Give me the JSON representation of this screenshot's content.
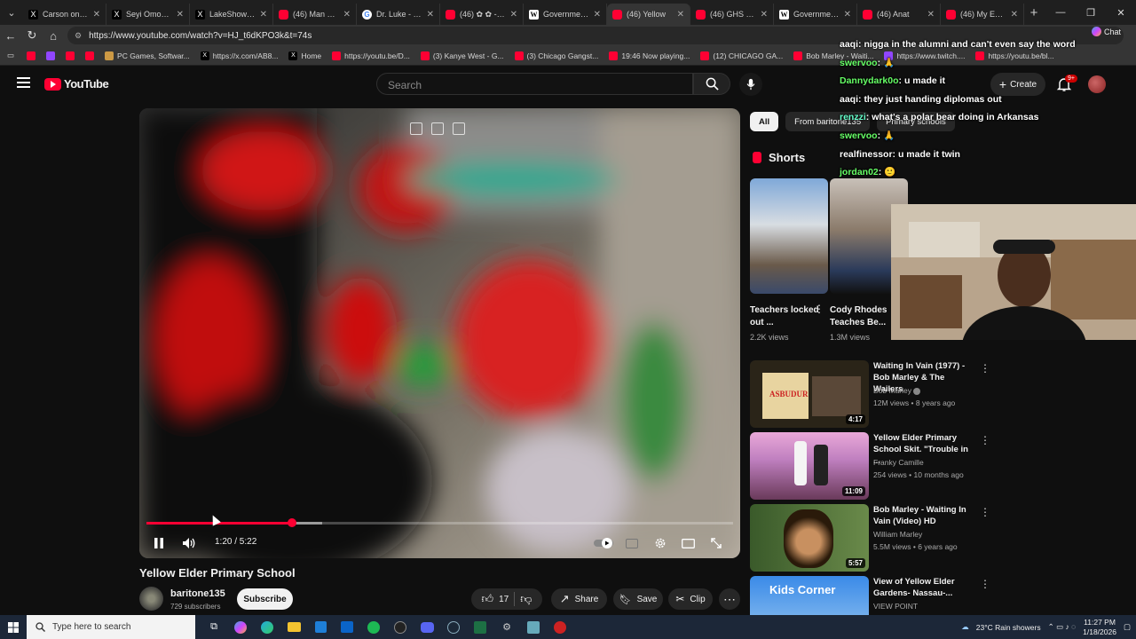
{
  "browser": {
    "tabs": [
      {
        "title": "Carson on X: \"I",
        "icon": "x"
      },
      {
        "title": "Seyi Omonira o",
        "icon": "x"
      },
      {
        "title": "LakeShowYo or",
        "icon": "x"
      },
      {
        "title": "(46) Man Creat",
        "icon": "yt"
      },
      {
        "title": "Dr. Luke - Goo",
        "icon": "g"
      },
      {
        "title": "(46) ✿ ✿ - Yo",
        "icon": "yt"
      },
      {
        "title": "Government H",
        "icon": "w"
      },
      {
        "title": "(46) Yellow",
        "icon": "yt",
        "active": true
      },
      {
        "title": "(46) GHS final",
        "icon": "yt"
      },
      {
        "title": "Government H",
        "icon": "w"
      },
      {
        "title": "(46) Anat",
        "icon": "yt"
      },
      {
        "title": "(46) My Entire",
        "icon": "yt"
      }
    ],
    "url": "https://www.youtube.com/watch?v=HJ_t6dKPO3k&t=74s",
    "bookmarks": [
      {
        "label": "",
        "icon": "yt"
      },
      {
        "label": "",
        "icon": "tw"
      },
      {
        "label": "",
        "icon": "yt"
      },
      {
        "label": "",
        "icon": "yt"
      },
      {
        "label": "PC Games, Softwar...",
        "icon": "steam"
      },
      {
        "label": "https://x.com/AB8...",
        "icon": "x"
      },
      {
        "label": "Home",
        "icon": "x"
      },
      {
        "label": "https://youtu.be/D...",
        "icon": "yt"
      },
      {
        "label": "(3) Kanye West - G...",
        "icon": "yt"
      },
      {
        "label": "(3) Chicago Gangst...",
        "icon": "yt"
      },
      {
        "label": "19:46 Now playing...",
        "icon": "yt"
      },
      {
        "label": "(12) CHICAGO GA...",
        "icon": "yt"
      },
      {
        "label": "Bob Marley - Waiti...",
        "icon": "yt"
      },
      {
        "label": "https://www.twitch....",
        "icon": "tw"
      },
      {
        "label": "https://youtu.be/bl...",
        "icon": "yt"
      }
    ]
  },
  "youtube": {
    "logo_text": "YouTube",
    "search_placeholder": "Search",
    "create_label": "Create",
    "notif_count": "9+",
    "chips": [
      "All",
      "From baritone135",
      "Primary schools"
    ],
    "shorts_label": "Shorts",
    "shorts": [
      {
        "title": "Teachers locked out ...",
        "views": "2.2K views"
      },
      {
        "title": "Cody Rhodes Teaches Be...",
        "views": "1.3M views"
      }
    ],
    "video": {
      "title": "Yellow Elder Primary School",
      "time": "1:20 / 5:22",
      "progress_fraction": 0.248,
      "buffered_fraction": 0.3,
      "channel": "baritone135",
      "subscribers": "729 subscribers",
      "subscribe_label": "Subscribe",
      "likes": "17",
      "share_label": "Share",
      "save_label": "Save",
      "clip_label": "Clip"
    },
    "recommended": [
      {
        "title": "Waiting In Vain (1977) - Bob Marley & The Wailers",
        "channel": "Bob Marley",
        "verified": true,
        "meta": "12M views • 8 years ago",
        "duration": "4:17"
      },
      {
        "title": "Yellow Elder Primary School Skit. \"Trouble in ...",
        "channel": "Franky Camille",
        "meta": "254 views • 10 months ago",
        "duration": "11:09"
      },
      {
        "title": "Bob Marley - Waiting In Vain (Video) HD",
        "channel": "William Marley",
        "meta": "5.5M views • 6 years ago",
        "duration": "5:57"
      },
      {
        "title": "View of Yellow Elder Gardens- Nassau-...",
        "channel": "VIEW POINT",
        "meta": "",
        "duration": ""
      }
    ],
    "kids_corner_text": "Kids Corner"
  },
  "stream_chat": {
    "chat_button": "Chat",
    "messages": [
      {
        "user": "aaqi",
        "text": "nigga in the alumni and can't even say the word",
        "color": "#ffffff"
      },
      {
        "user": "swervoo",
        "text": "🙏",
        "color": "#66ff66"
      },
      {
        "user": "Dannydark0o",
        "text": "u made it",
        "color": "#66ff66"
      },
      {
        "user": "aaqi",
        "text": "they just handing diplomas out",
        "color": "#ffffff"
      },
      {
        "user": "renzzi",
        "text": "what's a polar bear doing in Arkansas",
        "color": "#66ffcc"
      },
      {
        "user": "swervoo",
        "text": "🙏",
        "color": "#66ff66"
      },
      {
        "user": "realfinessor",
        "text": "u made it twin",
        "color": "#ffffff"
      },
      {
        "user": "jordan02",
        "text": "🙂",
        "color": "#66ff66"
      }
    ]
  },
  "taskbar": {
    "search_placeholder": "Type here to search",
    "weather": "23°C  Rain showers",
    "time": "11:27 PM",
    "date": "1/18/2026"
  },
  "colors": {
    "yt_red": "#ff0033",
    "bg": "#0f0f0f",
    "taskbar": "#1c2738"
  }
}
